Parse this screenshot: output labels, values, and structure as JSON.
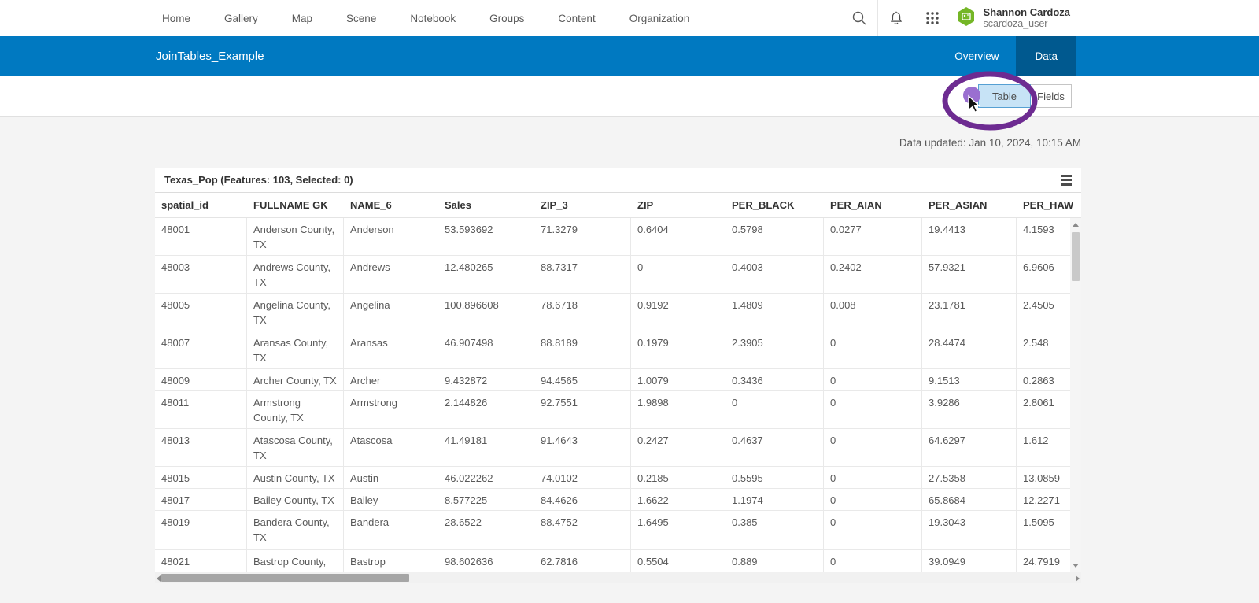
{
  "topnav": {
    "items": [
      "Home",
      "Gallery",
      "Map",
      "Scene",
      "Notebook",
      "Groups",
      "Content",
      "Organization"
    ],
    "user": {
      "name": "Shannon Cardoza",
      "username": "scardoza_user"
    },
    "icons": [
      "search-icon",
      "notifications-bell-icon",
      "app-launcher-grid-icon",
      "user-avatar-hexagon"
    ]
  },
  "banner": {
    "title": "JoinTables_Example",
    "tabs": [
      {
        "label": "Overview",
        "active": false
      },
      {
        "label": "Data",
        "active": true
      }
    ]
  },
  "toolbar": {
    "table_label": "Table",
    "fields_label": "Fields",
    "selected": "Table"
  },
  "status": {
    "updated": "Data updated: Jan 10, 2024, 10:15 AM"
  },
  "table": {
    "title": "Texas_Pop (Features: 103, Selected: 0)",
    "columns": [
      "spatial_id",
      "FULLNAME GK",
      "NAME_6",
      "Sales",
      "ZIP_3",
      "ZIP",
      "PER_BLACK",
      "PER_AIAN",
      "PER_ASIAN",
      "PER_HAW"
    ],
    "rows": [
      [
        "48001",
        "Anderson County, TX",
        "Anderson",
        "53.593692",
        "71.3279",
        "0.6404",
        "0.5798",
        "0.0277",
        "19.4413",
        "4.1593"
      ],
      [
        "48003",
        "Andrews County, TX",
        "Andrews",
        "12.480265",
        "88.7317",
        "0",
        "0.4003",
        "0.2402",
        "57.9321",
        "6.9606"
      ],
      [
        "48005",
        "Angelina County, TX",
        "Angelina",
        "100.896608",
        "78.6718",
        "0.9192",
        "1.4809",
        "0.008",
        "23.1781",
        "2.4505"
      ],
      [
        "48007",
        "Aransas County, TX",
        "Aransas",
        "46.907498",
        "88.8189",
        "0.1979",
        "2.3905",
        "0",
        "28.4474",
        "2.548"
      ],
      [
        "48009",
        "Archer County, TX",
        "Archer",
        "9.432872",
        "94.4565",
        "1.0079",
        "0.3436",
        "0",
        "9.1513",
        "0.2863"
      ],
      [
        "48011",
        "Armstrong County, TX",
        "Armstrong",
        "2.144826",
        "92.7551",
        "1.9898",
        "0",
        "0",
        "3.9286",
        "2.8061"
      ],
      [
        "48013",
        "Atascosa County, TX",
        "Atascosa",
        "41.49181",
        "91.4643",
        "0.2427",
        "0.4637",
        "0",
        "64.6297",
        "1.612"
      ],
      [
        "48015",
        "Austin County, TX",
        "Austin",
        "46.022262",
        "74.0102",
        "0.2185",
        "0.5595",
        "0",
        "27.5358",
        "13.0859"
      ],
      [
        "48017",
        "Bailey County, TX",
        "Bailey",
        "8.577225",
        "84.4626",
        "1.6622",
        "1.1974",
        "0",
        "65.8684",
        "12.2271"
      ],
      [
        "48019",
        "Bandera County, TX",
        "Bandera",
        "28.6522",
        "88.4752",
        "1.6495",
        "0.385",
        "0",
        "19.3043",
        "1.5095"
      ],
      [
        "48021",
        "Bastrop County, TX",
        "Bastrop",
        "98.602636",
        "62.7816",
        "0.5504",
        "0.889",
        "0",
        "39.0949",
        "24.7919"
      ]
    ]
  },
  "colors": {
    "banner_blue": "#0079c1",
    "active_tab_blue": "#00598f",
    "selected_button_bg": "#c7e3f6",
    "selected_button_border": "#56a0d3",
    "annotation_ellipse_purple": "#6d2b91",
    "annotation_dot_purple": "#9a6fd0",
    "avatar_green": "#74b626",
    "page_background": "#f4f4f4"
  }
}
